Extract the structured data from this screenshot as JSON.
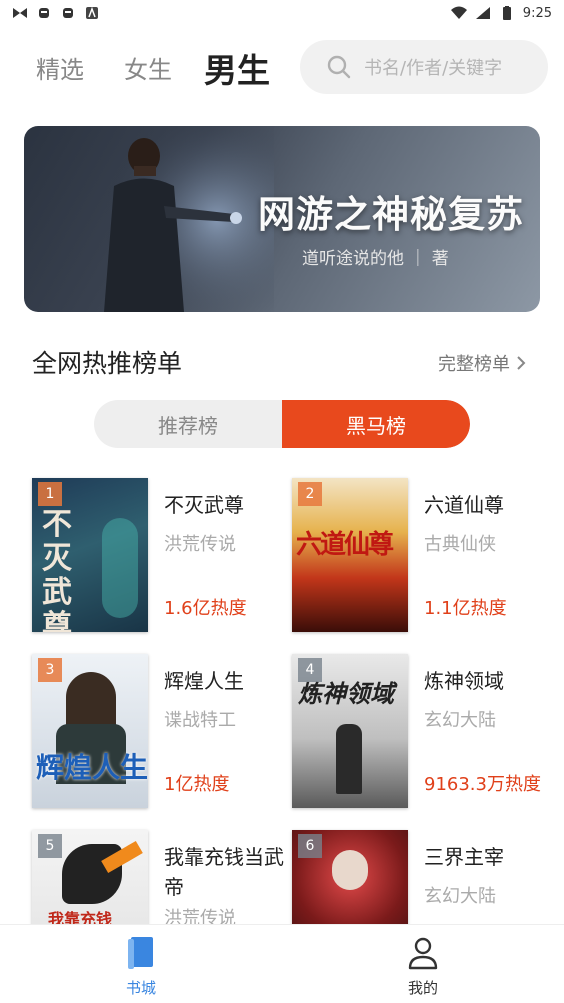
{
  "status": {
    "time": "9:25"
  },
  "nav": {
    "tabs": [
      {
        "label": "精选"
      },
      {
        "label": "女生"
      },
      {
        "label": "男生"
      }
    ],
    "search_placeholder": "书名/作者/关键字"
  },
  "banner": {
    "title": "网游之神秘复苏",
    "author": "道听途说的他 ｜ 著"
  },
  "section": {
    "title": "全网热推榜单",
    "more": "完整榜单"
  },
  "segments": {
    "left": "推荐榜",
    "right": "黑马榜"
  },
  "books": [
    {
      "rank": "1",
      "title": "不灭武尊",
      "genre": "洪荒传说",
      "heat": "1.6亿热度",
      "cover_text": "不灭武尊"
    },
    {
      "rank": "2",
      "title": "六道仙尊",
      "genre": "古典仙侠",
      "heat": "1.1亿热度",
      "cover_text": "六道仙尊"
    },
    {
      "rank": "3",
      "title": "辉煌人生",
      "genre": "谍战特工",
      "heat": "1亿热度",
      "cover_text": "辉煌人生"
    },
    {
      "rank": "4",
      "title": "炼神领域",
      "genre": "玄幻大陆",
      "heat": "9163.3万热度",
      "cover_text": "炼神领域"
    },
    {
      "rank": "5",
      "title": "我靠充钱当武帝",
      "genre": "洪荒传说",
      "heat": "",
      "cover_text": "我靠充钱"
    },
    {
      "rank": "6",
      "title": "三界主宰",
      "genre": "玄幻大陆",
      "heat": "",
      "cover_text": ""
    }
  ],
  "tabbar": {
    "home": "书城",
    "mine": "我的"
  },
  "colors": {
    "accent": "#e8491d",
    "tab_active": "#3a86e0"
  }
}
